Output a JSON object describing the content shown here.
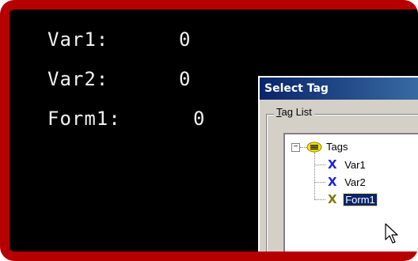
{
  "variables": [
    {
      "name": "Var1:",
      "value": "0"
    },
    {
      "name": "Var2:",
      "value": "0"
    },
    {
      "name": "Form1:",
      "value": "0"
    }
  ],
  "dialog": {
    "title": "Select Tag",
    "group_label_accel": "T",
    "group_label_rest": "ag List",
    "tree": {
      "root": {
        "expander": "−",
        "label": "Tags"
      },
      "items": [
        {
          "label": "Var1",
          "icon_color": "#1a22d8"
        },
        {
          "label": "Var2",
          "icon_color": "#1a22d8"
        },
        {
          "label": "Form1",
          "icon_color": "#7a7a00",
          "selected": true
        }
      ]
    }
  },
  "colors": {
    "frame": "#b60000",
    "screen": "#000000",
    "selection": "#0a246a"
  }
}
